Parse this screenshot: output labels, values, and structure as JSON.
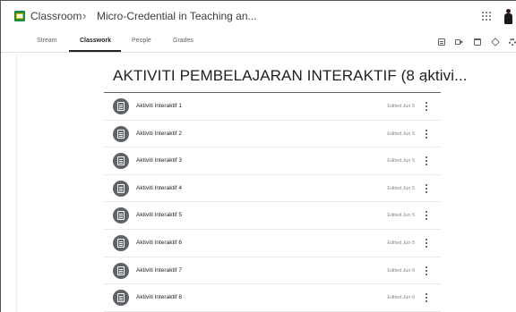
{
  "header": {
    "app_title": "Classroom",
    "breadcrumb_separator": "›",
    "course_title": "Micro-Credential in Teaching an...",
    "icons": [
      "google-apps-icon",
      "avatar"
    ]
  },
  "tabs": [
    {
      "label": "Stream",
      "active": false
    },
    {
      "label": "Classwork",
      "active": true
    },
    {
      "label": "People",
      "active": false
    },
    {
      "label": "Grades",
      "active": false
    }
  ],
  "toolbar_icons": [
    "google-forms-icon",
    "meet-video-icon",
    "calendar-icon",
    "drive-folder-icon",
    "settings-gear-icon"
  ],
  "topic": {
    "title": "AKTIVITI PEMBELAJARAN INTERAKTIF (8 aktivi..."
  },
  "items": [
    {
      "name": "Aktiviti Interaktif 1",
      "edited": "Edited Jun 5"
    },
    {
      "name": "Aktiviti Interaktif 2",
      "edited": "Edited Jun 5"
    },
    {
      "name": "Aktiviti Interaktif 3",
      "edited": "Edited Jun 5"
    },
    {
      "name": "Aktiviti Interaktif 4",
      "edited": "Edited Jun 5"
    },
    {
      "name": "Aktiviti Interaktif 5",
      "edited": "Edited Jun 5"
    },
    {
      "name": "Aktiviti Interaktif 6",
      "edited": "Edited Jun 5"
    },
    {
      "name": "Aktiviti Interaktif 7",
      "edited": "Edited Jun 6"
    },
    {
      "name": "Aktiviti Interaktif 8",
      "edited": "Edited Jun 6"
    }
  ],
  "colors": {
    "accent_green": "#1e8e3e",
    "accent_yellow": "#fbbc04",
    "icon_grey": "#5f6368",
    "text_dark": "#202124"
  }
}
